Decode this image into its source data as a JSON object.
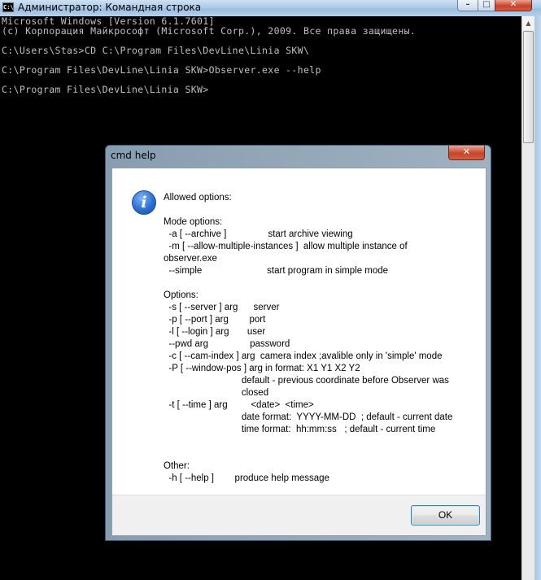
{
  "console_window": {
    "title": "Администратор: Командная строка",
    "app_icon_glyph": "C:\\",
    "lines": [
      "Microsoft Windows [Version 6.1.7601]",
      "(c) Корпорация Майкрософт (Microsoft Corp.), 2009. Все права защищены.",
      "",
      "C:\\Users\\Stas>CD C:\\Program Files\\DevLine\\Linia SKW\\",
      "",
      "C:\\Program Files\\DevLine\\Linia SKW>Observer.exe --help",
      "",
      "C:\\Program Files\\DevLine\\Linia SKW>"
    ],
    "buttons": {
      "minimize": "–",
      "maximize": "□",
      "close": "✕"
    }
  },
  "dialog": {
    "title": "cmd help",
    "close_glyph": "✕",
    "icon": "info-icon",
    "icon_glyph": "i",
    "lines": [
      "Allowed options:",
      "",
      "Mode options:",
      "  -a [ --archive ]                start archive viewing",
      "  -m [ --allow-multiple-instances ]  allow multiple instance of",
      "observer.exe",
      "  --simple                         start program in simple mode",
      "",
      "Options:",
      "  -s [ --server ] arg      server",
      "  -p [ --port ] arg        port",
      "  -l [ --login ] arg       user",
      "  --pwd arg                password",
      "  -c [ --cam-index ] arg  camera index ;avalible only in 'simple' mode",
      "  -P [ --window-pos ] arg in format: X1 Y1 X2 Y2",
      "                              default - previous coordinate before Observer was",
      "                              closed",
      "  -t [ --time ] arg         <date>  <time>",
      "                              date format:  YYYY-MM-DD  ; default - current date",
      "                              time format:  hh:mm:ss   ; default - current time",
      "",
      "",
      "Other:",
      "  -h [ --help ]        produce help message"
    ],
    "ok_label": "OK"
  },
  "colors": {
    "console_background": "#000000",
    "console_text": "#c0c0c0",
    "titlebar": "#aecbe8",
    "close_button": "#c7432a",
    "info_icon": "#2f6fd0"
  }
}
